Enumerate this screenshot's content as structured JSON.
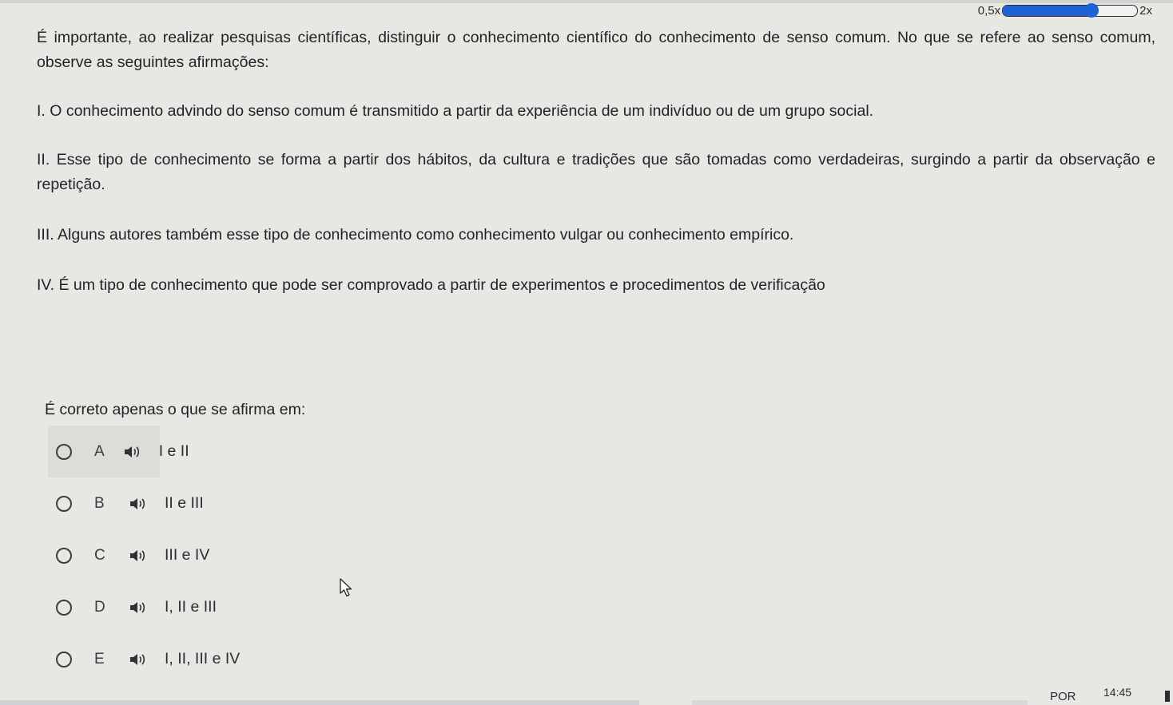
{
  "speed_control": {
    "min_label": "0,5x",
    "max_label": "2x",
    "value_fraction": 0.66
  },
  "question": {
    "intro": "É importante, ao realizar pesquisas científicas, distinguir o conhecimento científico do conhecimento de senso comum. No que se refere ao senso comum, observe as seguintes afirmações:",
    "statements": [
      "I. O conhecimento advindo do senso comum é transmitido a partir da experiência de um indivíduo ou de um grupo social.",
      "II. Esse tipo de conhecimento se forma a partir dos hábitos, da cultura e tradições que são tomadas como verdadeiras, surgindo a partir da observação e repetição.",
      "III. Alguns autores também esse tipo de conhecimento como conhecimento vulgar ou conhecimento empírico.",
      "IV. É um tipo de conhecimento que pode ser comprovado a partir de experimentos e procedimentos de verificação"
    ],
    "prompt": "É correto apenas o que se afirma em:"
  },
  "options": [
    {
      "letter": "A",
      "text": "I e II"
    },
    {
      "letter": "B",
      "text": "II e III"
    },
    {
      "letter": "C",
      "text": "III e IV"
    },
    {
      "letter": "D",
      "text": "I, II e III"
    },
    {
      "letter": "E",
      "text": "I, II, III e IV"
    }
  ],
  "taskbar": {
    "language": "POR",
    "time": "14:45"
  },
  "colors": {
    "accent": "#1e62d6",
    "background": "#e7e8e4",
    "hover": "#dcddd9"
  }
}
